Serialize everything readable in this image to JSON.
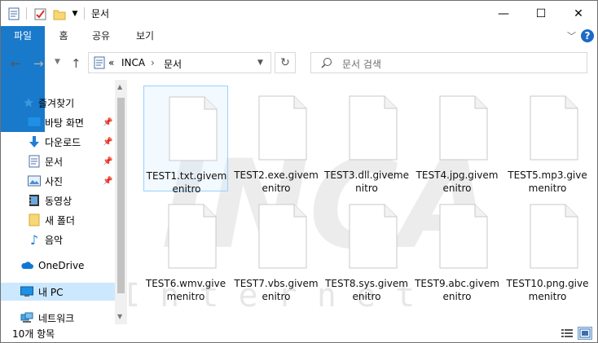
{
  "window": {
    "title": "문서"
  },
  "title_controls": {
    "minimize": "—",
    "maximize": "☐",
    "close": "✕"
  },
  "ribbon": {
    "tabs": [
      "파일",
      "홈",
      "공유",
      "보기"
    ],
    "expand_icon": "chevron-down",
    "help": "?"
  },
  "address": {
    "overflow": "«",
    "path": [
      "INCA",
      "문서"
    ],
    "search_placeholder": "문서 검색"
  },
  "nav": {
    "quick_access": "즐겨찾기",
    "items": [
      {
        "label": "바탕 화면",
        "icon": "desktop",
        "pinned": true
      },
      {
        "label": "다운로드",
        "icon": "download",
        "pinned": true
      },
      {
        "label": "문서",
        "icon": "documents",
        "pinned": true
      },
      {
        "label": "사진",
        "icon": "pictures",
        "pinned": true
      },
      {
        "label": "동영상",
        "icon": "videos",
        "pinned": false
      },
      {
        "label": "새 폴더",
        "icon": "folder",
        "pinned": false
      },
      {
        "label": "음악",
        "icon": "music",
        "pinned": false
      }
    ],
    "onedrive": "OneDrive",
    "this_pc": "내 PC",
    "network": "네트워크"
  },
  "files": [
    "TEST1.txt.givemenitro",
    "TEST2.exe.givemenitro",
    "TEST3.dll.givemenitro",
    "TEST4.jpg.givemenitro",
    "TEST5.mp3.givemenitro",
    "TEST6.wmv.givemenitro",
    "TEST7.vbs.givemenitro",
    "TEST8.sys.givemenitro",
    "TEST9.abc.givemenitro",
    "TEST10.png.givemenitro"
  ],
  "selected_file_index": 0,
  "watermark": {
    "logo": "INCA",
    "text": "I n t e r n e t"
  },
  "status": {
    "item_count": "10개 항목"
  },
  "colors": {
    "accent": "#1979ca",
    "selection": "#cce8ff",
    "selection_border": "#99d1ff"
  }
}
